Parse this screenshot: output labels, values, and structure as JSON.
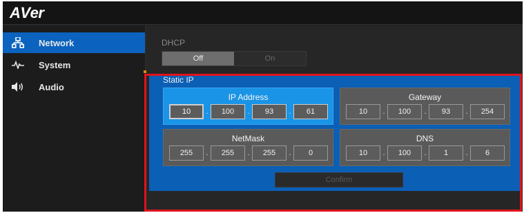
{
  "brand": {
    "logo_text_a": "A",
    "logo_text_v": "V",
    "logo_text_er": "er"
  },
  "sidebar": {
    "items": [
      {
        "label": "Network",
        "icon": "network-icon",
        "active": true
      },
      {
        "label": "System",
        "icon": "pulse-icon",
        "active": false
      },
      {
        "label": "Audio",
        "icon": "speaker-icon",
        "active": false
      }
    ]
  },
  "dhcp": {
    "label": "DHCP",
    "off_label": "Off",
    "on_label": "On",
    "selected": "Off"
  },
  "static_ip": {
    "label": "Static IP",
    "ip_address": {
      "title": "IP Address",
      "octets": [
        "10",
        "100",
        "93",
        "61"
      ]
    },
    "gateway": {
      "title": "Gateway",
      "octets": [
        "10",
        "100",
        "93",
        "254"
      ]
    },
    "netmask": {
      "title": "NetMask",
      "octets": [
        "255",
        "255",
        "255",
        "0"
      ]
    },
    "dns": {
      "title": "DNS",
      "octets": [
        "10",
        "100",
        "1",
        "6"
      ]
    },
    "confirm_label": "Confirm"
  },
  "colors": {
    "accent_blue": "#0b63bf",
    "selected_card": "#1a94e6",
    "highlight_red": "#e0141e"
  }
}
